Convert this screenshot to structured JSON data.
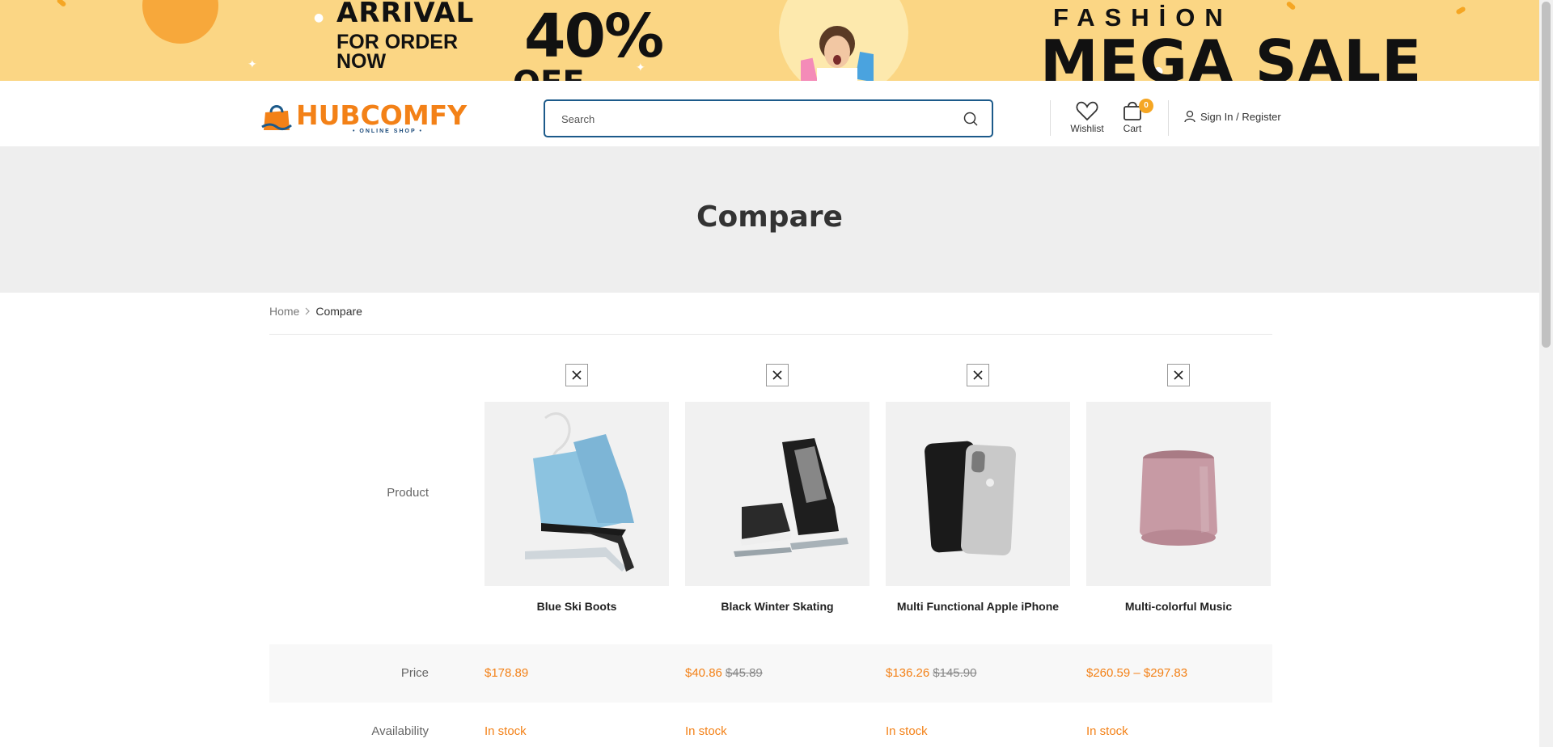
{
  "promo": {
    "arrival": "ARRİVAL",
    "order_line1": "FOR ORDER",
    "order_line2": "NOW",
    "percent": "40%",
    "off": "OFF",
    "fashion": "FASHİON",
    "mega_sale": "MEGA SALE",
    "colors": {
      "background": "#fbd684",
      "accent": "#f7a83b"
    }
  },
  "header": {
    "logo_text": "HUBCOMFY",
    "logo_sub": "• ONLINE SHOP •",
    "search_placeholder": "Search",
    "wishlist_label": "Wishlist",
    "cart_label": "Cart",
    "cart_count": "0",
    "signin_label": "Sign In",
    "register_separator": " / ",
    "register_label": "Register"
  },
  "page_title": "Compare",
  "breadcrumb": {
    "home": "Home",
    "current": "Compare"
  },
  "compare": {
    "row_labels": {
      "product": "Product",
      "price": "Price",
      "availability": "Availability"
    },
    "products": [
      {
        "name": "Blue Ski Boots",
        "price": "$178.89",
        "old_price": "",
        "availability": "In stock"
      },
      {
        "name": "Black Winter Skating",
        "price": "$40.86",
        "old_price": "$45.89",
        "availability": "In stock"
      },
      {
        "name": "Multi Functional Apple iPhone",
        "price": "$136.26",
        "old_price": "$145.90",
        "availability": "In stock"
      },
      {
        "name": "Multi-colorful Music",
        "price": "$260.59 – $297.83",
        "old_price": "",
        "availability": "In stock"
      }
    ]
  },
  "colors": {
    "brand_orange": "#f38117",
    "search_border": "#1c5a8a",
    "title_band": "#eeeeee"
  }
}
